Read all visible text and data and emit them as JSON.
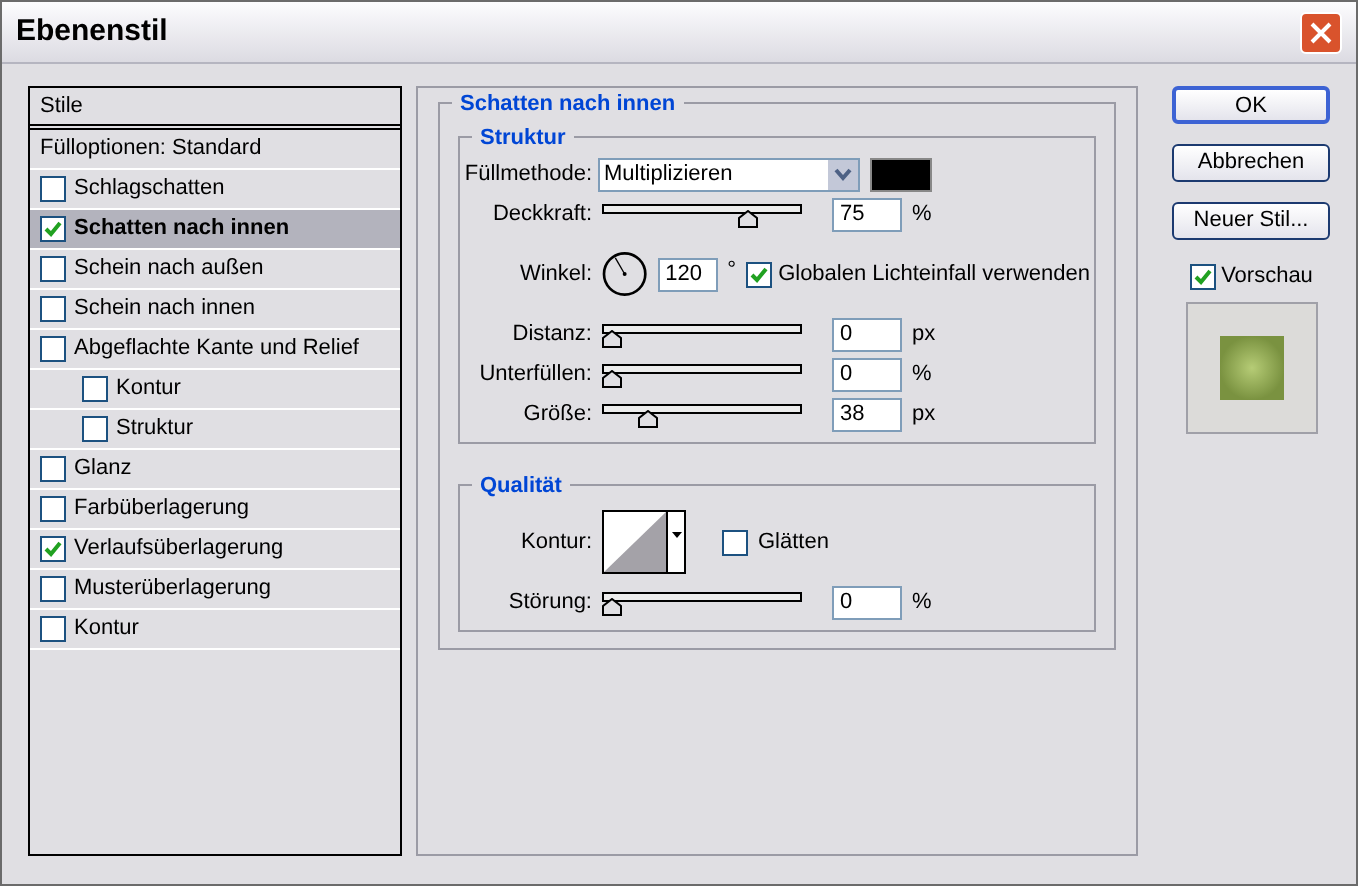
{
  "window": {
    "title": "Ebenenstil"
  },
  "styles": {
    "header": "Stile",
    "items": [
      {
        "kind": "plain",
        "label": "Fülloptionen: Standard",
        "selected": false
      },
      {
        "kind": "checkbox",
        "label": "Schlagschatten",
        "checked": false,
        "selected": false
      },
      {
        "kind": "checkbox",
        "label": "Schatten nach innen",
        "checked": true,
        "selected": true
      },
      {
        "kind": "checkbox",
        "label": "Schein nach außen",
        "checked": false,
        "selected": false
      },
      {
        "kind": "checkbox",
        "label": "Schein nach innen",
        "checked": false,
        "selected": false
      },
      {
        "kind": "checkbox",
        "label": "Abgeflachte Kante und Relief",
        "checked": false,
        "selected": false,
        "children": [
          {
            "kind": "checkbox",
            "label": "Kontur",
            "checked": false,
            "selected": false
          },
          {
            "kind": "checkbox",
            "label": "Struktur",
            "checked": false,
            "selected": false
          }
        ]
      },
      {
        "kind": "checkbox",
        "label": "Glanz",
        "checked": false,
        "selected": false
      },
      {
        "kind": "checkbox",
        "label": "Farbüberlagerung",
        "checked": false,
        "selected": false
      },
      {
        "kind": "checkbox",
        "label": "Verlaufsüberlagerung",
        "checked": true,
        "selected": false
      },
      {
        "kind": "checkbox",
        "label": "Musterüberlagerung",
        "checked": false,
        "selected": false
      },
      {
        "kind": "checkbox",
        "label": "Kontur",
        "checked": false,
        "selected": false
      }
    ]
  },
  "panel": {
    "title": "Schatten nach innen",
    "groups": [
      {
        "title": "Struktur",
        "rows": [
          {
            "kind": "select",
            "label": "Füllmethode:",
            "value": "Multiplizieren",
            "color": "#000000"
          },
          {
            "kind": "slider",
            "label": "Deckkraft:",
            "level": 0.75,
            "value": "75",
            "unit": "%"
          },
          {
            "kind": "angle",
            "label": "Winkel:",
            "value": "120",
            "unit": "°",
            "checkbox": {
              "label": "Globalen Lichteinfall verwenden",
              "checked": true
            }
          },
          {
            "kind": "slider",
            "label": "Distanz:",
            "level": 0,
            "value": "0",
            "unit": "px"
          },
          {
            "kind": "slider",
            "label": "Unterfüllen:",
            "level": 0,
            "value": "0",
            "unit": "%"
          },
          {
            "kind": "slider",
            "label": "Größe:",
            "level": 0.2,
            "value": "38",
            "unit": "px"
          }
        ]
      },
      {
        "title": "Qualität",
        "rows": [
          {
            "kind": "contour",
            "label": "Kontur:",
            "checkbox": {
              "label": "Glätten",
              "checked": false
            }
          },
          {
            "kind": "slider",
            "label": "Störung:",
            "level": 0,
            "value": "0",
            "unit": "%"
          }
        ]
      }
    ]
  },
  "buttons": [
    {
      "label": "OK",
      "default": true
    },
    {
      "label": "Abbrechen",
      "default": false
    },
    {
      "label": "Neuer Stil...",
      "default": false
    }
  ],
  "preview": {
    "label": "Vorschau",
    "checked": true
  }
}
